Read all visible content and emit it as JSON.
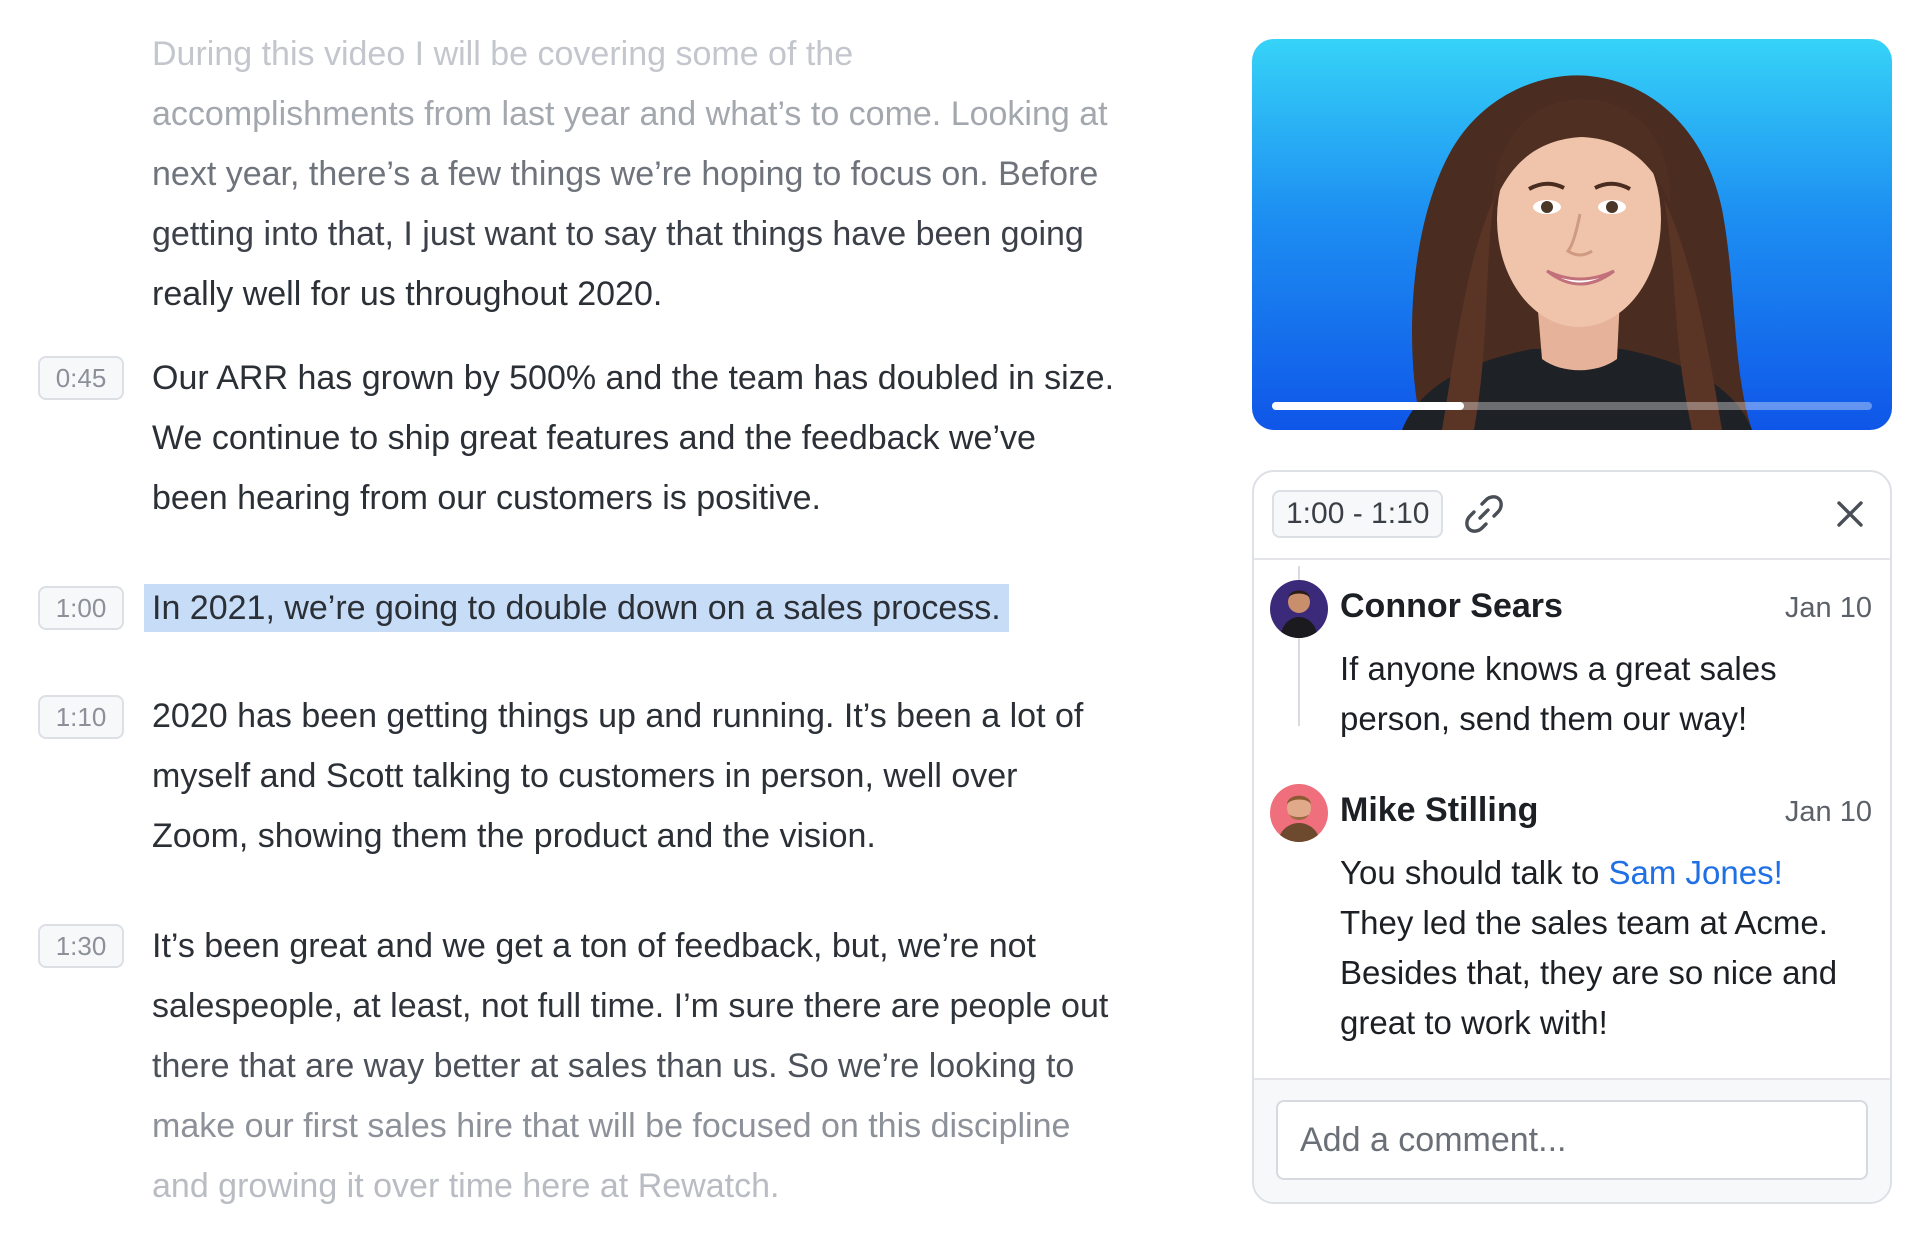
{
  "transcript": {
    "intro_lines": [
      "During this video I will be covering some of the",
      "accomplishments from last year and what’s to come. Looking at",
      "next year, there’s a few things we’re hoping to focus on. Before",
      "getting into that, I just want to say that things have been going",
      "really well for us throughout 2020."
    ],
    "segments": [
      {
        "timestamp": "0:45",
        "lines": [
          "Our ARR has grown by 500% and the team has doubled in size.",
          "We continue to ship great features and the feedback we’ve",
          "been hearing from our customers is positive."
        ]
      },
      {
        "timestamp": "1:00",
        "lines": [
          "In 2021, we’re going to double down on a sales process."
        ]
      },
      {
        "timestamp": "1:10",
        "lines": [
          "2020 has been getting things up and running. It’s been a lot of",
          "myself and Scott talking to customers in person, well over",
          "Zoom, showing them the product and the vision."
        ]
      },
      {
        "timestamp": "1:30",
        "lines": [
          "It’s been great and we get a ton of feedback, but, we’re not",
          "salespeople, at least, not full time. I’m sure there are people out",
          "there that are way better at sales than us. So we’re looking to",
          "make our first sales hire that will be focused on this discipline",
          "and growing it over time here at Rewatch."
        ]
      }
    ]
  },
  "video": {
    "progress_fraction": 0.32
  },
  "comment_panel": {
    "range_label": "1:00 - 1:10",
    "link_icon": "link-icon",
    "close_icon": "close-icon",
    "comments": [
      {
        "author": "Connor Sears",
        "date": "Jan 10",
        "lines": [
          "If anyone knows a great sales",
          "person, send them our way!"
        ]
      },
      {
        "author": "Mike Stilling",
        "date": "Jan 10",
        "first_line_prefix": "You should talk to ",
        "mention": "Sam Jones!",
        "lines": [
          "They led the sales team at Acme.",
          "Besides that, they are so nice and",
          "great to work with!"
        ]
      }
    ],
    "composer": {
      "placeholder": "Add a comment..."
    }
  },
  "colors": {
    "highlight": "#c6dcf7",
    "mention": "#1f6fe5",
    "video_gradient_top": "#36d3f7",
    "video_gradient_bottom": "#0f56e8"
  }
}
